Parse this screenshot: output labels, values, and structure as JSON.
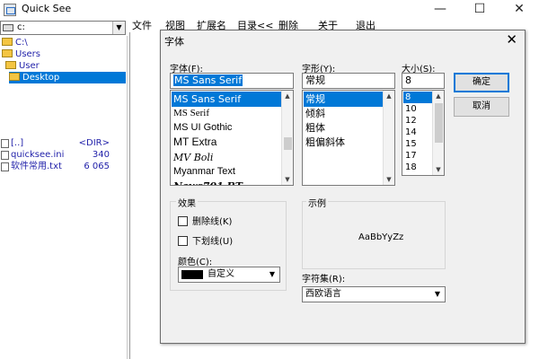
{
  "window": {
    "title": "Quick See",
    "controls": {
      "minimize": "—",
      "maximize": "☐",
      "close": "✕"
    }
  },
  "drive": {
    "value": "c:"
  },
  "tree": [
    {
      "label": "C:\\",
      "selected": false
    },
    {
      "label": "Users",
      "selected": false
    },
    {
      "label": "User",
      "selected": false
    },
    {
      "label": "Desktop",
      "selected": true
    }
  ],
  "files": [
    {
      "name": "[..]",
      "size": "<DIR>"
    },
    {
      "name": "quicksee.ini",
      "size": "340"
    },
    {
      "name": "软件常用.txt",
      "size": "6 065"
    }
  ],
  "menu": {
    "items": [
      "文件",
      "视图",
      "扩展名",
      "目录<<",
      "删除",
      "关于",
      "退出"
    ]
  },
  "dialog": {
    "title": "字体",
    "close": "✕",
    "font_label": "字体(F):",
    "font_value": "MS Sans Serif",
    "fonts": [
      "MS Sans Serif",
      "MS Serif",
      "MS UI Gothic",
      "MT Extra",
      "MV Boli",
      "Myanmar Text",
      "News701 BT"
    ],
    "style_label": "字形(Y):",
    "style_value": "常规",
    "styles": [
      "常规",
      "倾斜",
      "粗体",
      "粗偏斜体"
    ],
    "size_label": "大小(S):",
    "size_value": "8",
    "sizes": [
      "8",
      "10",
      "12",
      "14",
      "15",
      "17",
      "18"
    ],
    "ok_button": "确定",
    "cancel_button": "取消",
    "effects_label": "效果",
    "strikeout_label": "删除线(K)",
    "underline_label": "下划线(U)",
    "color_label": "颜色(C):",
    "color_value": "自定义",
    "sample_label": "示例",
    "sample_text": "AaBbYyZz",
    "charset_label": "字符集(R):",
    "charset_value": "西欧语言"
  }
}
